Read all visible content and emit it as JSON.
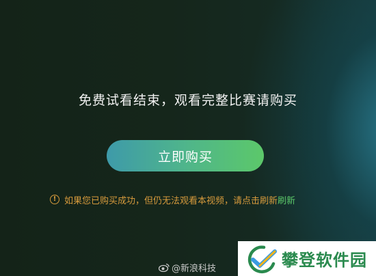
{
  "paywall": {
    "message": "免费试看结束，观看完整比赛请购买",
    "buy_button_label": "立即购买",
    "notice_text": "如果您已购买成功，但仍无法观看本视频，请点击刷新",
    "refresh_link_label": "刷新",
    "info_icon": "info-circle-icon"
  },
  "watermark": {
    "weibo_handle": "@新浪科技",
    "weibo_icon": "weibo-icon"
  },
  "brand_badge": {
    "text": "攀登软件园",
    "logo_icon": "checkmark-shield-icon"
  },
  "colors": {
    "accent_green": "#5cc86a",
    "accent_teal": "#3e9aa9",
    "notice_orange": "#d69a3c"
  }
}
